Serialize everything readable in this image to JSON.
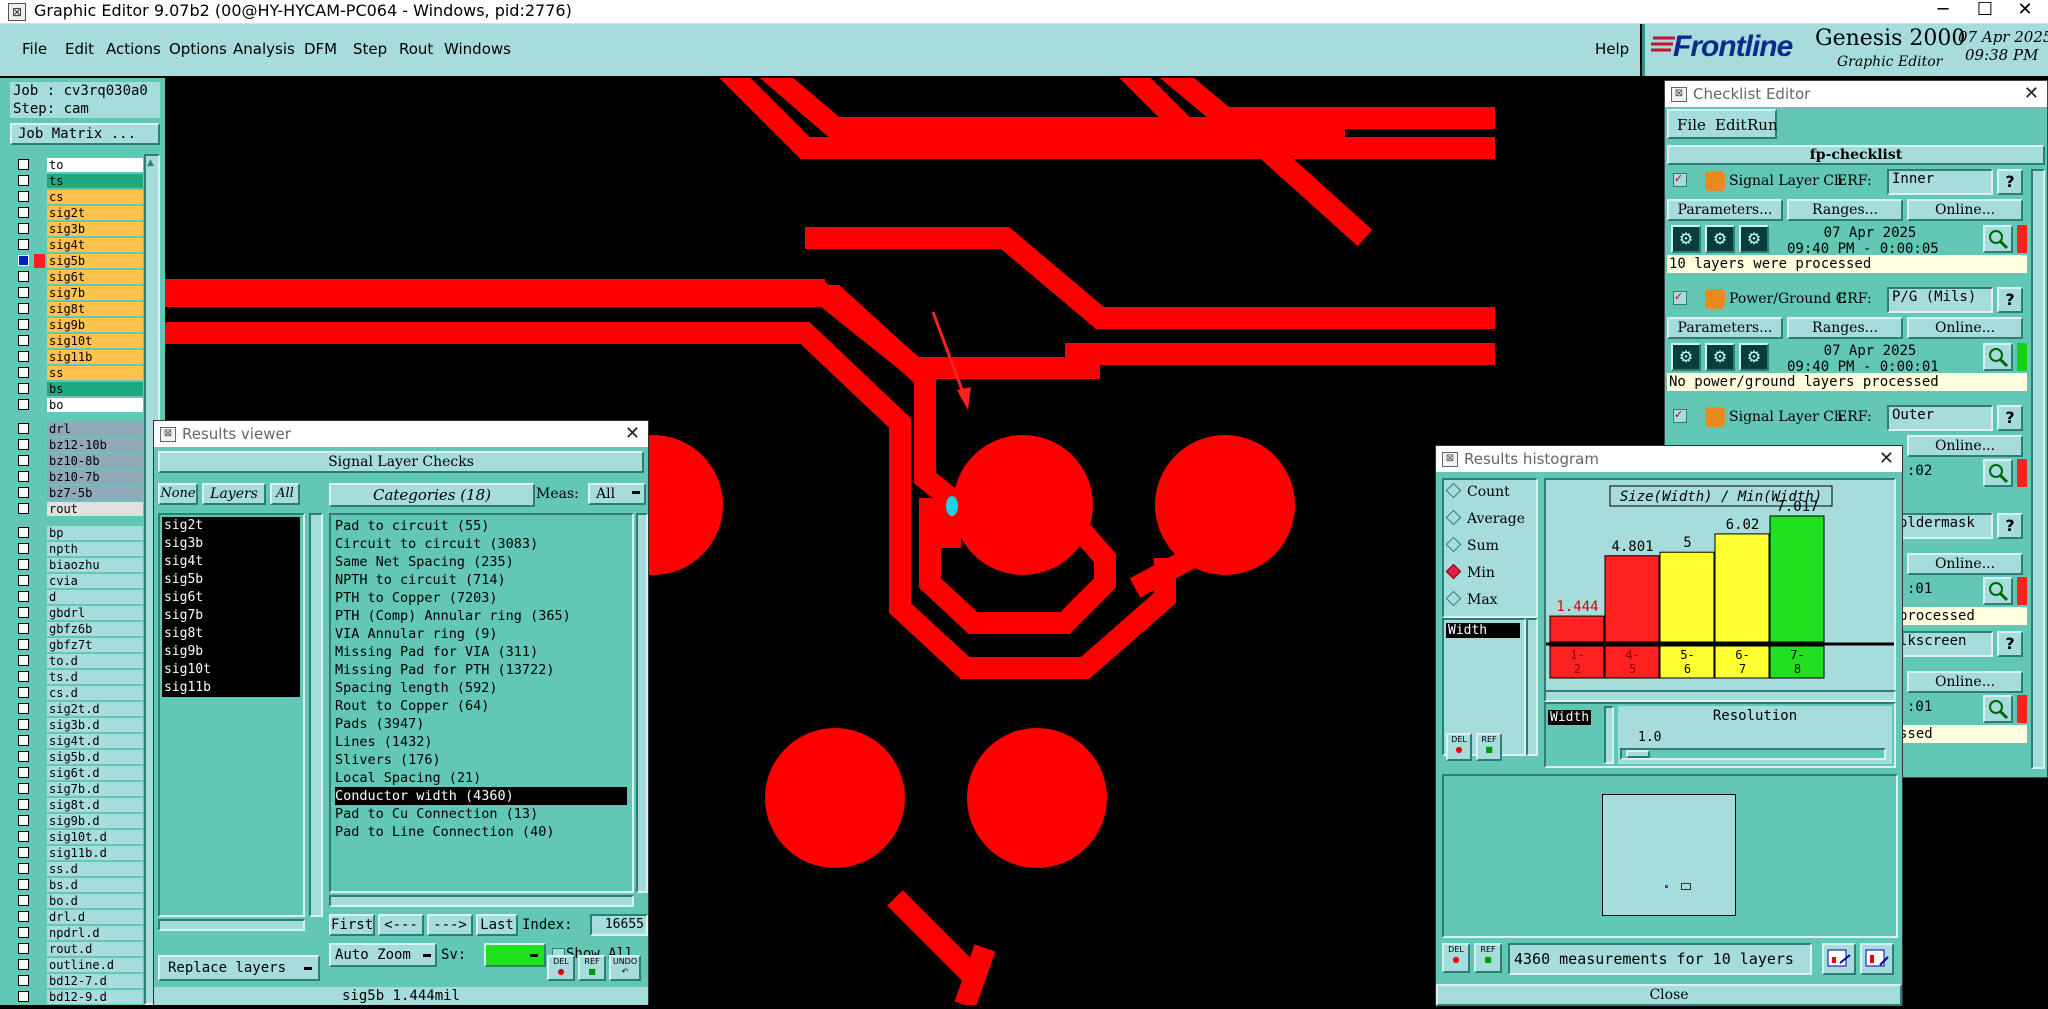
{
  "window": {
    "title": "Graphic Editor 9.07b2 (00@HY-HYCAM-PC064 - Windows, pid:2776)"
  },
  "menu": {
    "items": [
      "File",
      "Edit",
      "Actions",
      "Options",
      "Analysis",
      "DFM",
      "Step",
      "Rout",
      "Windows"
    ],
    "help": "Help"
  },
  "brand": {
    "logo": "Frontline",
    "product": "Genesis 2000",
    "subtitle": "Graphic Editor",
    "date": "07 Apr 2025",
    "time": "09:38 PM"
  },
  "job": {
    "job_label": "Job : cv3rq030a0",
    "step_label": "Step: cam",
    "matrix_button": "Job Matrix ..."
  },
  "layers": {
    "group1": [
      {
        "name": "to",
        "color": "#ffffff"
      },
      {
        "name": "ts",
        "color": "#1faa80"
      },
      {
        "name": "cs",
        "color": "#ffc34d"
      },
      {
        "name": "sig2t",
        "color": "#ffc34d"
      },
      {
        "name": "sig3b",
        "color": "#ffc34d"
      },
      {
        "name": "sig4t",
        "color": "#ffc34d"
      },
      {
        "name": "sig5b",
        "color": "#ffc34d"
      },
      {
        "name": "sig6t",
        "color": "#ffc34d"
      },
      {
        "name": "sig7b",
        "color": "#ffc34d"
      },
      {
        "name": "sig8t",
        "color": "#ffc34d"
      },
      {
        "name": "sig9b",
        "color": "#ffc34d"
      },
      {
        "name": "sig10t",
        "color": "#ffc34d"
      },
      {
        "name": "sig11b",
        "color": "#ffc34d"
      },
      {
        "name": "ss",
        "color": "#ffc34d"
      },
      {
        "name": "bs",
        "color": "#1faa80"
      },
      {
        "name": "bo",
        "color": "#ffffff"
      }
    ],
    "group2": [
      {
        "name": "drl",
        "color": "#8fa9b8"
      },
      {
        "name": "bz12-10b",
        "color": "#8fa9b8"
      },
      {
        "name": "bz10-8b",
        "color": "#8fa9b8"
      },
      {
        "name": "bz10-7b",
        "color": "#8fa9b8"
      },
      {
        "name": "bz7-5b",
        "color": "#8fa9b8"
      },
      {
        "name": "rout",
        "color": "#e0e0e0"
      }
    ],
    "group3": [
      "bp",
      "npth",
      "biaozhu",
      "cvia",
      "d",
      "gbdrl",
      "gbfz6b",
      "gbfz7t",
      "to.d",
      "ts.d",
      "cs.d",
      "sig2t.d",
      "sig3b.d",
      "sig4t.d",
      "sig5b.d",
      "sig6t.d",
      "sig7b.d",
      "sig8t.d",
      "sig9b.d",
      "sig10t.d",
      "sig11b.d",
      "ss.d",
      "bs.d",
      "bo.d",
      "drl.d",
      "npdrl.d",
      "rout.d",
      "outline.d",
      "bd12-7.d",
      "bd12-9.d"
    ]
  },
  "results_viewer": {
    "title": "Results viewer",
    "header": "Signal Layer Checks",
    "none_btn": "None",
    "layers_btn": "Layers",
    "all_btn": "All",
    "categories_label": "Categories (18)",
    "meas_label": "Meas:",
    "meas_value": "All",
    "layers": [
      "sig2t",
      "sig3b",
      "sig4t",
      "sig5b",
      "sig6t",
      "sig7b",
      "sig8t",
      "sig9b",
      "sig10t",
      "sig11b"
    ],
    "categories": [
      "Pad to circuit (55)",
      "Circuit to circuit (3083)",
      "Same Net Spacing (235)",
      "NPTH to circuit (714)",
      "PTH to Copper (7203)",
      "PTH (Comp) Annular ring (365)",
      "VIA Annular ring (9)",
      "Missing Pad for VIA (311)",
      "Missing Pad for PTH (13722)",
      "Spacing length (592)",
      "Rout to Copper (64)",
      "Pads (3947)",
      "Lines (1432)",
      "Slivers (176)",
      "Local Spacing (21)",
      "Conductor width (4360)",
      "Pad to Cu Connection (13)",
      "Pad to Line Connection (40)"
    ],
    "selected_category": "Conductor width (4360)",
    "first_btn": "First",
    "prev_btn": "<---",
    "next_btn": "--->",
    "last_btn": "Last",
    "index_label": "Index:",
    "index_value": "16655",
    "zoom_label": "Auto Zoom",
    "sv_label": "Sv:",
    "show_all": "Show All",
    "replace_layers": "Replace layers",
    "del": "DEL",
    "ref": "REF",
    "undo": "UNDO",
    "status": "sig5b 1.444mil"
  },
  "checklist": {
    "title": "Checklist Editor",
    "menu": [
      "File",
      "Edit",
      "Run"
    ],
    "name": "fp-checklist",
    "checks": [
      {
        "name": "Signal Layer Ch",
        "erf_label": "ERF:",
        "erf": "Inner",
        "params": "Parameters...",
        "ranges": "Ranges...",
        "online": "Online...",
        "date": "07 Apr 2025",
        "time": "09:40 PM - 0:00:05",
        "msg": "10 layers were processed",
        "status_color": "#ff2020"
      },
      {
        "name": "Power/Ground C",
        "erf_label": "ERF:",
        "erf": "P/G (Mils)",
        "params": "Parameters...",
        "ranges": "Ranges...",
        "online": "Online...",
        "date": "07 Apr 2025",
        "time": "09:40 PM - 0:00:01",
        "msg": "No power/ground layers processed",
        "status_color": "#18d018"
      },
      {
        "name": "Signal Layer Ch",
        "erf_label": "ERF:",
        "erf": "Outer"
      }
    ],
    "partial": [
      {
        "online": "Online...",
        "time": ":02",
        "msg": "",
        "erf": "oldermask"
      },
      {
        "online": "Online...",
        "time": ":01",
        "msg": "processed",
        "erf": "lkscreen"
      },
      {
        "online": "Online...",
        "time": ":01",
        "msg": "ssed"
      }
    ]
  },
  "histogram": {
    "title": "Results histogram",
    "options": [
      "Count",
      "Average",
      "Sum",
      "Min",
      "Max"
    ],
    "selected_option": "Min",
    "list_item": "Width",
    "chart_title": "Size(Width) / Min(Width)",
    "field_label": "Width",
    "resolution_label": "Resolution",
    "resolution_value": "1.0",
    "footer": "4360 measurements for 10 layers",
    "close": "Close",
    "del": "DEL",
    "ref": "REF"
  },
  "chart_data": {
    "type": "bar",
    "title": "Size(Width) / Min(Width)",
    "categories": [
      "1-2",
      "4-5",
      "5-6",
      "6-7",
      "7-8"
    ],
    "values": [
      1.444,
      4.801,
      5,
      6.02,
      7.017
    ],
    "value_labels": [
      "1.444",
      "4.801",
      "5",
      "6.02",
      "7.017"
    ],
    "colors": [
      "#ff2020",
      "#ff2020",
      "#ffff30",
      "#ffff30",
      "#20e020"
    ],
    "ylim": [
      0,
      7.017
    ]
  }
}
